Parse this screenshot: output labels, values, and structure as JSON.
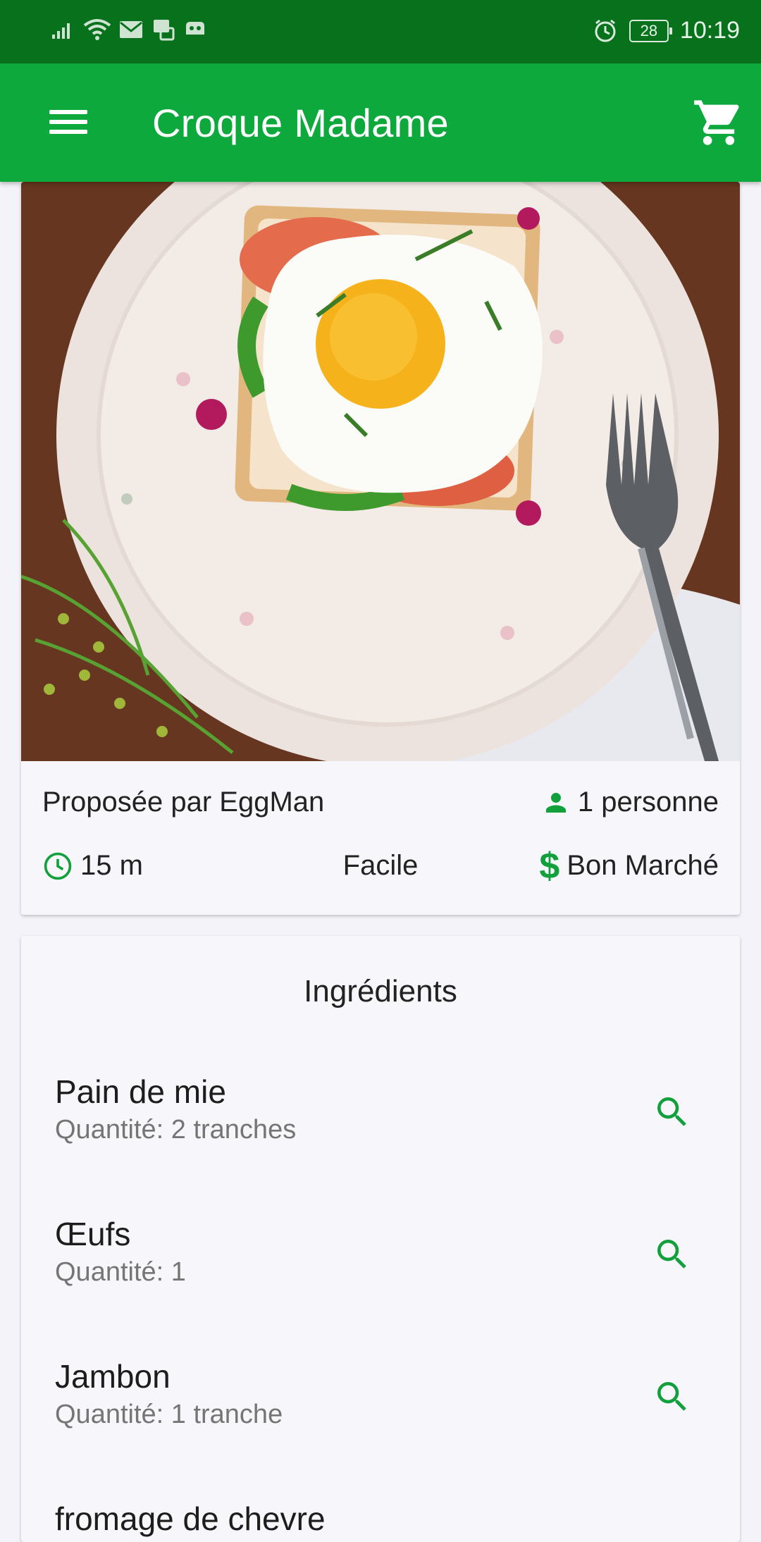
{
  "status_bar": {
    "time": "10:19",
    "battery": "28",
    "icons_left": [
      "signal-icon",
      "wifi-icon",
      "mail-icon",
      "notification-icon",
      "game-icon"
    ],
    "icons_right": [
      "alarm-icon",
      "battery-icon"
    ]
  },
  "app_bar": {
    "title": "Croque Madame",
    "menu_icon": "menu-icon",
    "cart_icon": "cart-icon"
  },
  "recipe": {
    "author": "Proposée par EggMan",
    "servings": "1 personne",
    "time": "15 m",
    "difficulty": "Facile",
    "cost": "Bon Marché"
  },
  "ingredients": {
    "title": "Ingrédients",
    "items": [
      {
        "name": "Pain de mie",
        "quantity": "Quantité: 2 tranches"
      },
      {
        "name": "Œufs",
        "quantity": "Quantité: 1"
      },
      {
        "name": "Jambon",
        "quantity": "Quantité: 1 tranche"
      },
      {
        "name": "fromage de chevre",
        "quantity": ""
      }
    ]
  },
  "colors": {
    "status_bar": "#08711b",
    "app_bar": "#0ea93d",
    "accent": "#12a03d",
    "background": "#f4f3f9"
  }
}
